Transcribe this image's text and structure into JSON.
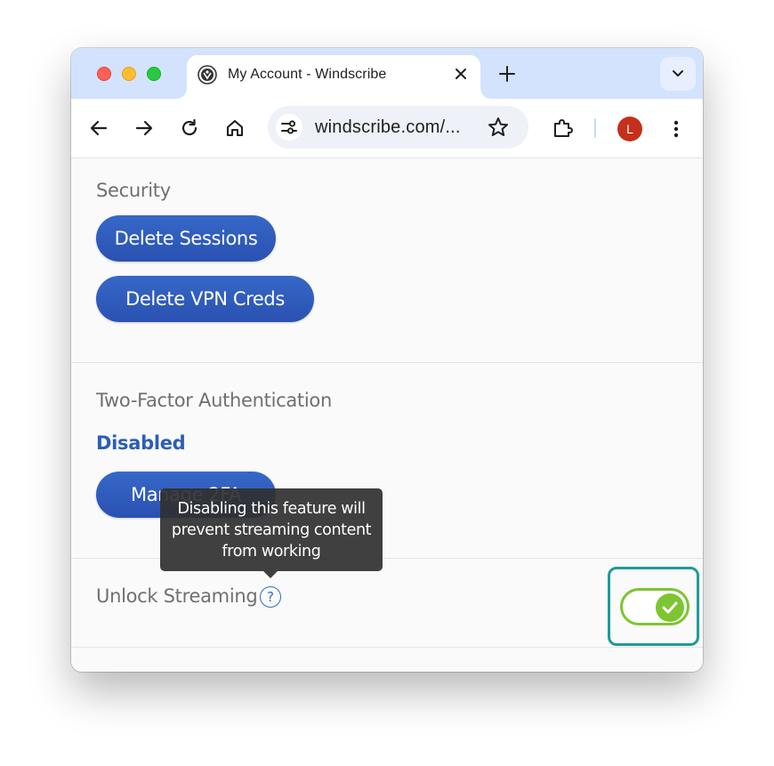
{
  "browser": {
    "tab": {
      "title": "My Account - Windscribe",
      "favicon": "windscribe-logo-icon"
    },
    "address_bar": {
      "url": "windscribe.com/..."
    },
    "profile_initial": "L"
  },
  "security": {
    "heading": "Security",
    "buttons": {
      "delete_sessions": "Delete Sessions",
      "delete_vpn_creds": "Delete VPN Creds"
    }
  },
  "two_factor": {
    "heading": "Two-Factor Authentication",
    "status": "Disabled",
    "manage_button": "Manage 2FA"
  },
  "streaming": {
    "label": "Unlock Streaming",
    "help_glyph": "?",
    "tooltip": "Disabling this feature will prevent streaming content from working",
    "toggle_on": true
  },
  "colors": {
    "button_blue": "#2f5dbd",
    "status_blue": "#2b5eb8",
    "toggle_green": "#7dc531",
    "focus_teal": "#1e9a9a"
  }
}
